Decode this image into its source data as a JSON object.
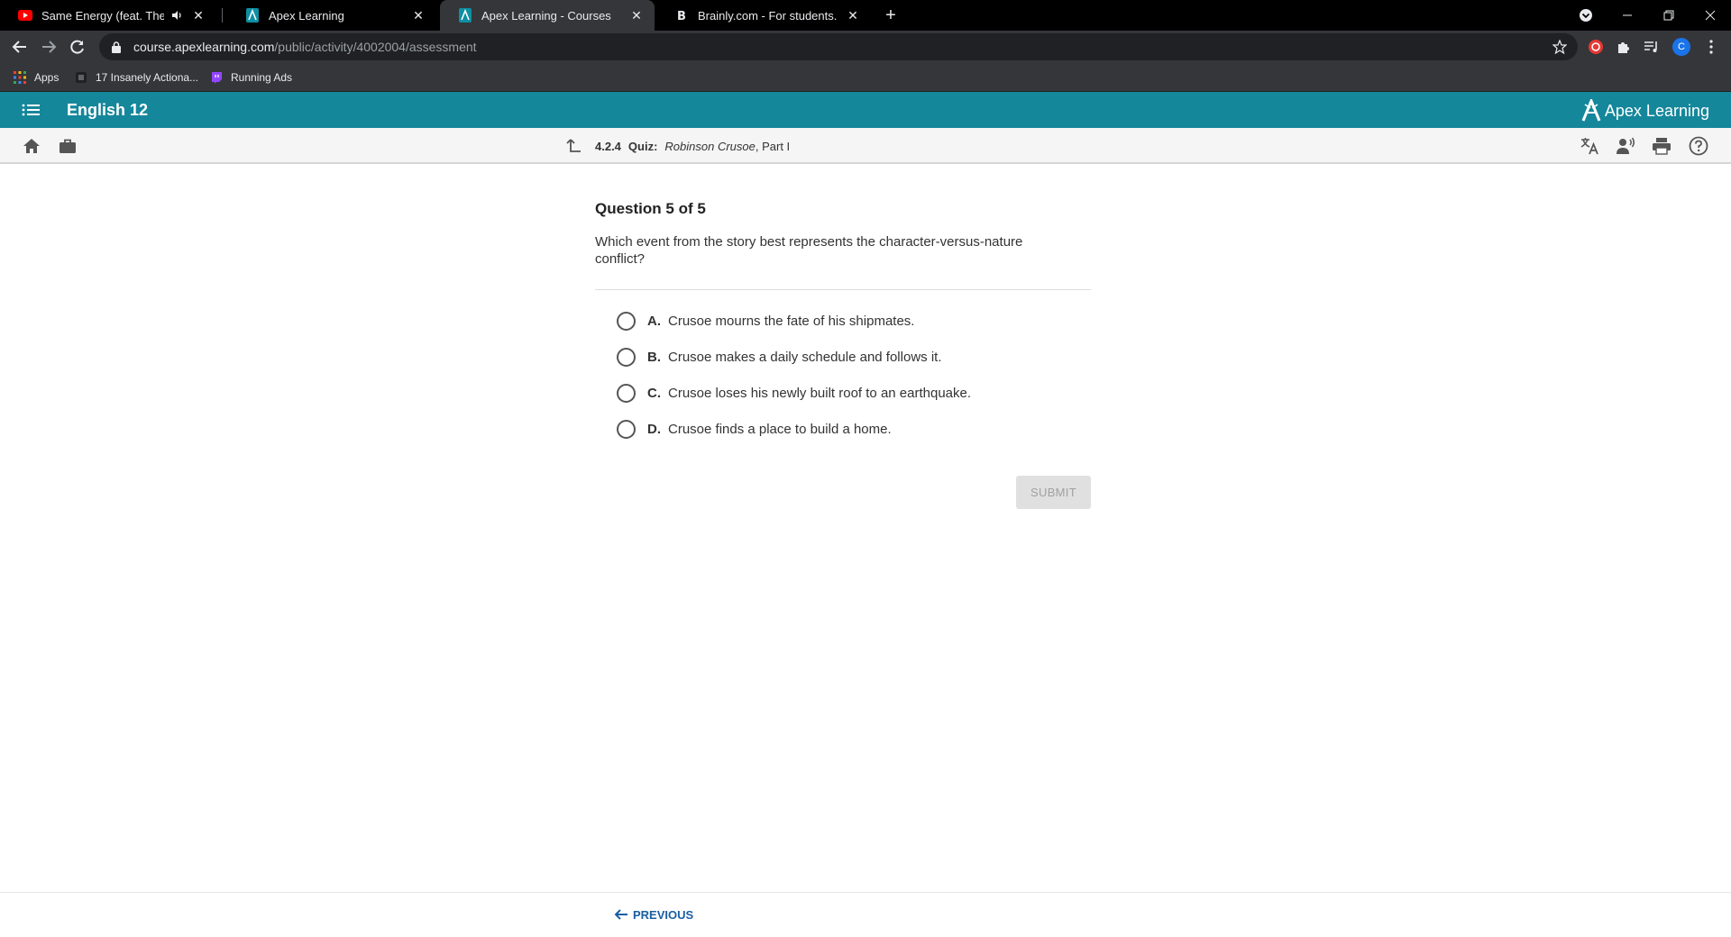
{
  "browser": {
    "tabs": [
      {
        "title": "Same Energy (feat. The Kid L",
        "favicon": "youtube-icon",
        "muted_audio": true
      },
      {
        "title": "Apex Learning",
        "favicon": "apex-icon"
      },
      {
        "title": "Apex Learning - Courses",
        "favicon": "apex-icon",
        "active": true
      },
      {
        "title": "Brainly.com - For students. By stu",
        "favicon": "brainly-icon"
      }
    ],
    "url_host": "course.apexlearning.com",
    "url_path": "/public/activity/4002004/assessment",
    "profile_initial": "C",
    "bookmarks": [
      {
        "label": "Apps",
        "icon": "apps-grid-icon"
      },
      {
        "label": "17 Insanely Actiona...",
        "icon": "bookmark-page-icon"
      },
      {
        "label": "Running Ads",
        "icon": "twitch-icon"
      }
    ]
  },
  "app": {
    "course_title": "English 12",
    "brand_name": "Apex Learning",
    "accent_color": "#15879b"
  },
  "breadcrumb": {
    "number": "4.2.4",
    "kind": "Quiz:",
    "work_title": "Robinson Crusoe",
    "part": ", Part I"
  },
  "question": {
    "header": "Question 5 of 5",
    "text": "Which event from the story best represents the character-versus-nature conflict?",
    "options": [
      {
        "letter": "A.",
        "text": "Crusoe mourns the fate of his shipmates."
      },
      {
        "letter": "B.",
        "text": "Crusoe makes a daily schedule and follows it."
      },
      {
        "letter": "C.",
        "text": "Crusoe loses his newly built roof to an earthquake."
      },
      {
        "letter": "D.",
        "text": "Crusoe finds a place to build a home."
      }
    ],
    "submit_label": "SUBMIT"
  },
  "footer": {
    "previous_label": "PREVIOUS"
  }
}
